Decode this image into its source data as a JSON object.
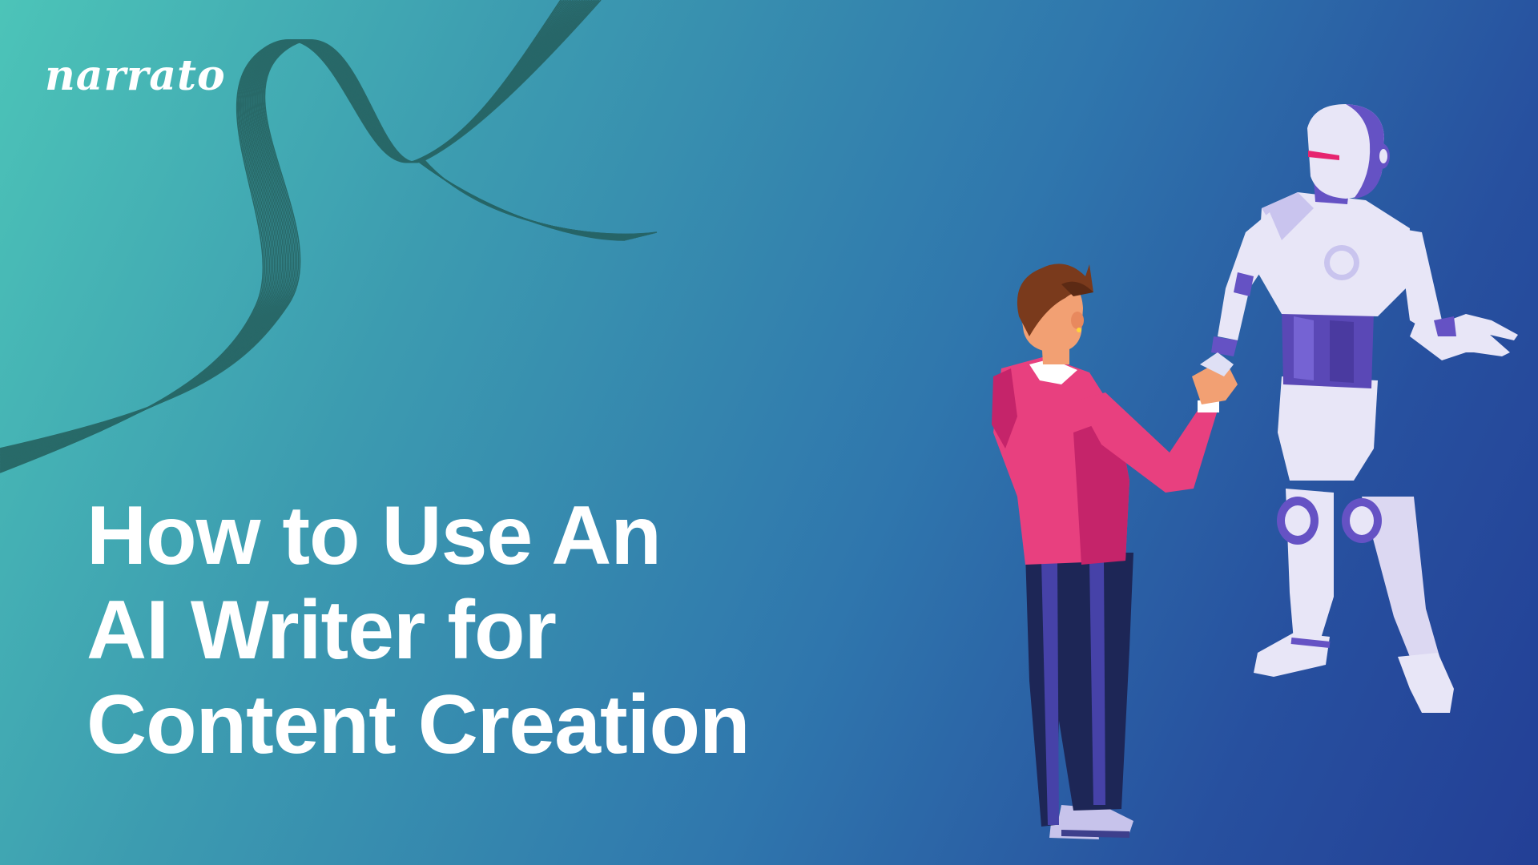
{
  "brand": {
    "logo_text": "narrato"
  },
  "headline": {
    "lines": [
      "How to Use An",
      "AI Writer for",
      "Content Creation"
    ]
  },
  "illustration": {
    "subject": "person shaking hands with humanoid robot"
  },
  "colors": {
    "gradient_start": "#4cc4b8",
    "gradient_end": "#233f96",
    "text": "#ffffff",
    "wave_lines": "#245e5c",
    "shirt": "#e8407f",
    "robot_body": "#e8e6f7",
    "robot_accent": "#6552c4",
    "robot_visor": "#e6246f"
  }
}
